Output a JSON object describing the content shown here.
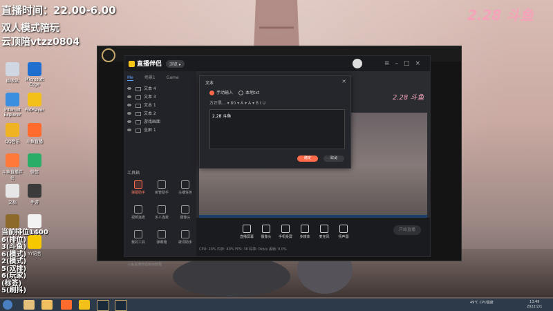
{
  "overlay": {
    "line1": "直播时间：22.00-6.00",
    "line2": "双人模式陪玩",
    "line3": "云顶陪vtzz0804"
  },
  "left_list": [
    "当前排位1400",
    "6(排位)",
    "3(斗鱼)",
    "6(模式)",
    "2(模式)",
    "5(双排)",
    "6(玩家)",
    "(标签)",
    "5(刷抖)"
  ],
  "brand": "2.28 斗鱼",
  "desktop_icons": [
    {
      "label": "回收站",
      "color": "#cfd7e3"
    },
    {
      "label": "Microsoft Edge",
      "color": "#1f6fd1"
    },
    {
      "label": "Internet Explorer",
      "color": "#3a8fe0"
    },
    {
      "label": "PotPlayer",
      "color": "#f3c019"
    },
    {
      "label": "QQ音乐",
      "color": "#f0b323"
    },
    {
      "label": "斗鱼直播",
      "color": "#ff6b2c"
    },
    {
      "label": "斗鱼直播伴侣",
      "color": "#ff7a3a"
    },
    {
      "label": "微信",
      "color": "#2aae67"
    },
    {
      "label": "文档",
      "color": "#e6e6e6"
    },
    {
      "label": "手游",
      "color": "#3b3b3b"
    },
    {
      "label": "pbe",
      "color": "#8b6a2b"
    },
    {
      "label": "Wowan",
      "color": "#f2f2f2"
    },
    {
      "label": "YY语音",
      "color": "#f5c800"
    }
  ],
  "app": {
    "logo": "直播伴侣",
    "pill": "浏览 ▸",
    "side_tabs": [
      "Me",
      "场景1",
      "Game"
    ],
    "scenes": [
      "文本 4",
      "文本 3",
      "文本 1",
      "文本 2",
      "游戏画面",
      "全屏 1"
    ],
    "tools_label": "工具箱",
    "tools": [
      {
        "label": "弹幕助手",
        "red": true
      },
      {
        "label": "房管助手",
        "red": false
      },
      {
        "label": "主播任务",
        "red": false
      },
      {
        "label": "视频连麦",
        "red": false
      },
      {
        "label": "多人连麦",
        "red": false
      },
      {
        "label": "摄像头",
        "red": false
      },
      {
        "label": "我的工具",
        "red": false
      },
      {
        "label": "弹幕箱",
        "red": false
      },
      {
        "label": "歌词助手",
        "red": false
      }
    ],
    "bottom_hint": "斗鱼直播伴侣使用教程",
    "controls": [
      "直播屏幕",
      "摄像头",
      "手机投屏",
      "多媒体",
      "麦克风",
      "扬声器"
    ],
    "start_live": "开始直播",
    "status": "CPU: 20%  内存: 40%  FPS: 30  码率: 0kb/s  丢帧: 0.0%"
  },
  "dialog": {
    "title": "文本",
    "radio_manual": "手动输入",
    "radio_file": "本地txt",
    "format_bar": "方正黑... ▾  80 ▾  A ▾  A ▾  B  I  U",
    "content": "2.28 斗鱼",
    "ok": "确定",
    "cancel": "取消"
  },
  "pink_date": "2.28 斗鱼",
  "taskbar": {
    "tray": "49℃ CPU温度",
    "time": "13:49",
    "date": "2022/2/1"
  },
  "colors": {
    "accent": "#ff6b4a",
    "link": "#5aa0ff",
    "brand": "#f5a3b8"
  }
}
